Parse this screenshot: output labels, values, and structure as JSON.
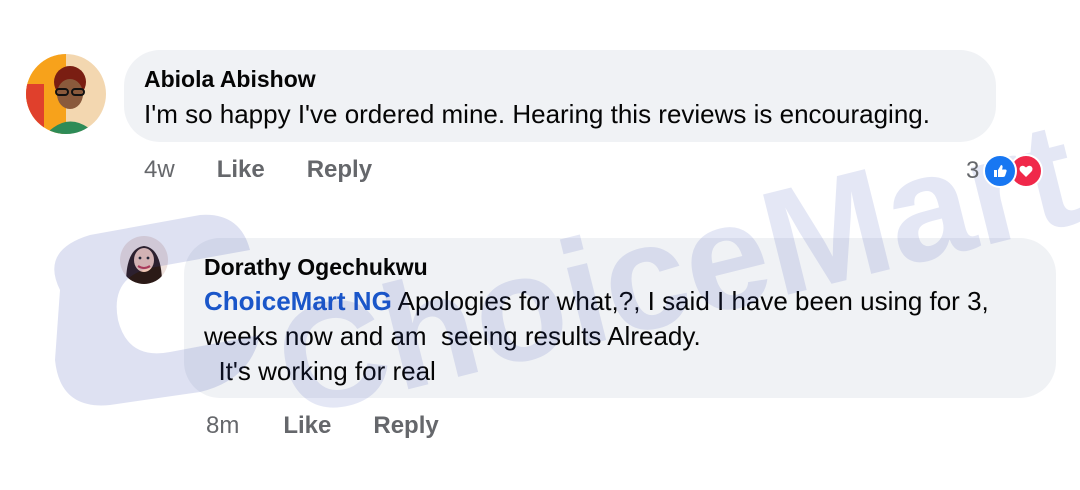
{
  "comments": [
    {
      "author": "Abiola Abishow",
      "text": "I'm so happy I've ordered mine. Hearing this reviews is encouraging.",
      "time": "4w",
      "like_label": "Like",
      "reply_label": "Reply",
      "reaction_count": "3",
      "reaction_icons": [
        "like-icon",
        "love-icon"
      ],
      "colors": {
        "like": "#1877f2",
        "love": "#f0284a"
      }
    },
    {
      "author": "Dorathy Ogechukwu",
      "mention": "ChoiceMart NG",
      "line1": " Apologies for what,?, I said I have been using for 3,",
      "line2": "weeks now and am  seeing results Already.",
      "line3": "  It's working for real",
      "time": "8m",
      "like_label": "Like",
      "reply_label": "Reply"
    }
  ],
  "watermark": "ChoiceMart NG"
}
